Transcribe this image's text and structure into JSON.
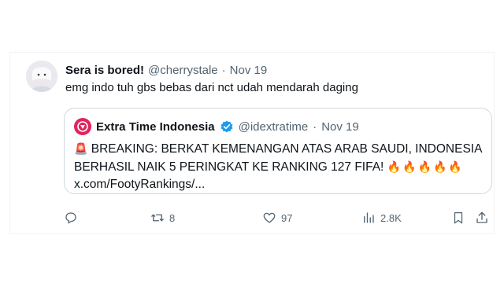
{
  "tweet": {
    "author_name": "Sera is bored!",
    "author_handle": "@cherrystale",
    "separator": "·",
    "date": "Nov 19",
    "text": "emg indo tuh gbs bebas dari nct udah mendarah daging"
  },
  "quote": {
    "author_name": "Extra Time Indonesia",
    "author_handle": "@idextratime",
    "separator": "·",
    "date": "Nov 19",
    "line1": "BREAKING: BERKAT KEMENANGAN ATAS ARAB SAUDI, INDONESIA",
    "line2": "BERHASIL NAIK 5 PERINGKAT KE RANKING 127 FIFA!",
    "link": "x.com/FootyRankings/...",
    "emoji_siren": "🚨",
    "emoji_fire": "🔥🔥🔥🔥🔥"
  },
  "actions": {
    "reply": "",
    "retweets": "8",
    "likes": "97",
    "views": "2.8K"
  },
  "icons": {
    "reply": "reply-icon",
    "retweet": "retweet-icon",
    "like": "heart-icon",
    "views": "views-icon",
    "bookmark": "bookmark-icon",
    "share": "share-icon",
    "verified": "verified-badge-icon",
    "siren": "siren-icon",
    "fire": "fire-icon"
  },
  "colors": {
    "muted": "#536471",
    "verified": "#1d9bf0",
    "border": "#cfd9de"
  }
}
